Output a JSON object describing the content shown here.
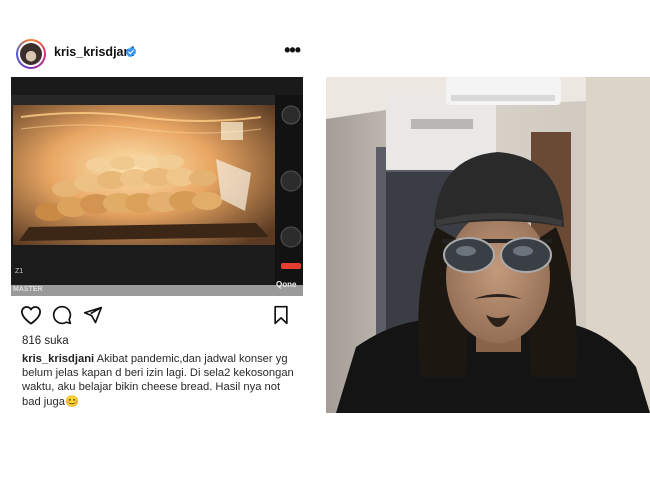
{
  "post": {
    "username": "kris_krisdjani",
    "more_icon": "more-horizontal-icon",
    "likes": "816 suka",
    "caption_user": "kris_krisdjani",
    "caption_text": " Akibat pandemic,dan jadwal konser yg belum jelas kapan d beri izin lagi. Di sela2 kekosongan waktu, aku belajar bikin cheese bread. Hasil nya not bad juga",
    "caption_emoji": "😊",
    "oven_brand": "MASTER",
    "oven_logo": "Qone",
    "oven_model": "Z1"
  },
  "colors": {
    "verified": "#3797f0",
    "oven_light": "#f2b56b",
    "bread": "#d9a15a"
  }
}
